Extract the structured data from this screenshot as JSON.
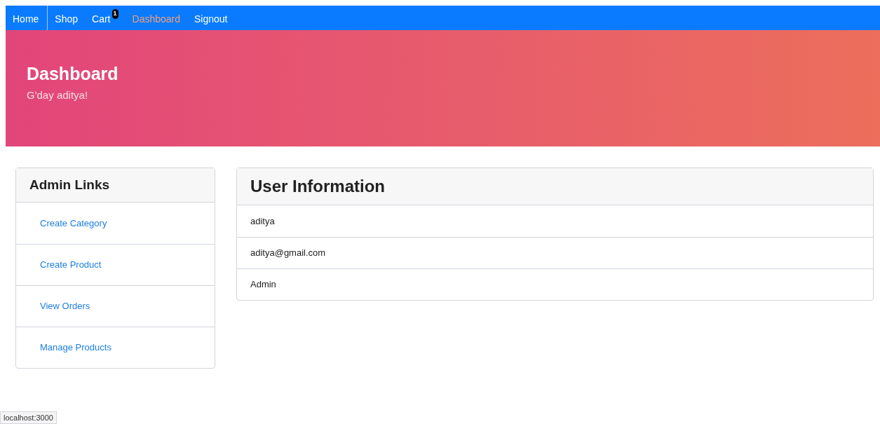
{
  "nav": [
    {
      "label": "Home",
      "selected": false
    },
    {
      "label": "Shop",
      "selected": false
    },
    {
      "label": "Cart",
      "selected": false,
      "badge": "1"
    },
    {
      "label": "Dashboard",
      "selected": true
    },
    {
      "label": "Signout",
      "selected": false
    }
  ],
  "banner": {
    "title": "Dashboard",
    "subtitle": "G'day aditya!"
  },
  "admin_links": {
    "title": "Admin Links",
    "items": [
      "Create Category",
      "Create Product",
      "View Orders",
      "Manage Products"
    ]
  },
  "user_info": {
    "title": "User Information",
    "rows": [
      "aditya",
      "aditya@gmail.com",
      "Admin"
    ]
  },
  "status_bar": "localhost:3000"
}
